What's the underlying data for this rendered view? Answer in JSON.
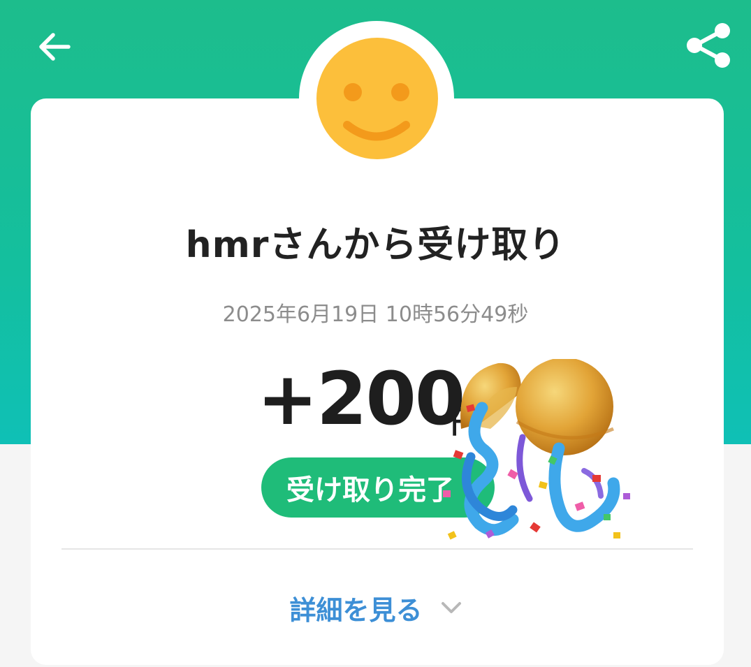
{
  "header": {
    "back_icon": "arrow-left-icon",
    "share_icon": "share-icon",
    "colors": {
      "top": "#1dbd8c",
      "bottom": "#0fc0b6"
    }
  },
  "avatar": {
    "icon": "smiley-face-icon",
    "color": "#fcbf3b"
  },
  "transaction": {
    "title": "hmrさんから受け取り",
    "datetime": "2025年6月19日 10時56分49秒",
    "amount": "+200",
    "amount_unit": "円",
    "status": "受け取り完了",
    "status_color": "#1fbc79"
  },
  "details": {
    "label": "詳細を見る",
    "icon": "chevron-down-icon",
    "color": "#3d8fd6"
  },
  "decoration": {
    "icon": "party-popper-confetti-icon"
  }
}
